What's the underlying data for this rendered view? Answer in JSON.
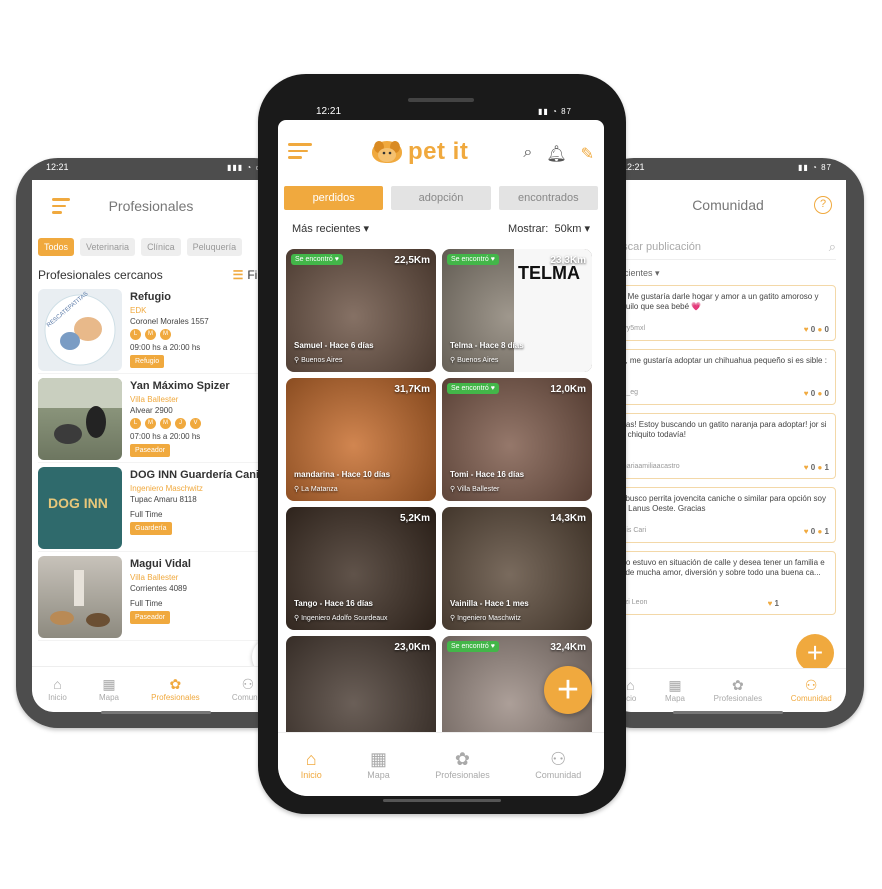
{
  "brand": {
    "name": "pet it",
    "accent": "#f0a93e"
  },
  "left": {
    "status": {
      "time": "12:21",
      "icons": "▮▮▮ ◔ ▭"
    },
    "title": "Profesionales",
    "chips": [
      "Todos",
      "Veterinaria",
      "Clínica",
      "Peluquería"
    ],
    "subheader": "Profesionales cercanos",
    "filter_label": "Filtra",
    "items": [
      {
        "name": "Refugio",
        "sub": "EDK",
        "address": "Coronel Morales 1557",
        "days": [
          "L",
          "M",
          "M"
        ],
        "hours": "09:00 hs a 20:00 hs",
        "tag": "Refugio",
        "thumb_text": "RESCATEPATITAS"
      },
      {
        "name": "Yan Máximo Spizer",
        "sub": "Villa Ballester",
        "address": "Alvear 2900",
        "days": [
          "L",
          "M",
          "M",
          "J",
          "V"
        ],
        "hours": "07:00 hs a 20:00 hs",
        "tag": "Paseador"
      },
      {
        "name": "DOG INN Guardería Canin",
        "sub": "Ingeniero Maschwitz",
        "address": "Tupac Amaru 8118",
        "days": [],
        "hours": "Full Time",
        "tag": "Guardería",
        "thumb_text": "DOG INN"
      },
      {
        "name": "Magui Vidal",
        "sub": "Villa Ballester",
        "address": "Corrientes 4089",
        "days": [],
        "hours": "Full Time",
        "tag": "Paseador"
      }
    ],
    "nav": [
      "Inicio",
      "Mapa",
      "Profesionales",
      "Comunid"
    ]
  },
  "center": {
    "status": {
      "time": "12:21",
      "icons": "▮▮ ◔ 87"
    },
    "tabs": [
      "perdidos",
      "adopción",
      "encontrados"
    ],
    "sort": "Más recientes",
    "show_label": "Mostrar:",
    "show_value": "50km",
    "cards": [
      {
        "dist": "22,5Km",
        "found": "Se encontró ♥",
        "name": "Samuel - Hace 6 días",
        "loc": "Buenos Aires",
        "bg": "#6b5243"
      },
      {
        "dist": "23,3Km",
        "found": "Se encontró ♥",
        "name": "Telma - Hace 8 días",
        "loc": "Buenos Aires",
        "bg": "#8a8174",
        "poster": "TELMA"
      },
      {
        "dist": "31,7Km",
        "found": "",
        "name": "mandarina - Hace 10 días",
        "loc": "La Matanza",
        "bg": "#c76b2a"
      },
      {
        "dist": "12,0Km",
        "found": "Se encontró ♥",
        "name": "Tomi - Hace 16 días",
        "loc": "Villa Ballester",
        "bg": "#7e5a4a"
      },
      {
        "dist": "5,2Km",
        "found": "",
        "name": "Tango - Hace 16 días",
        "loc": "Ingeniero Adolfo Sourdeaux",
        "bg": "#3d2d22"
      },
      {
        "dist": "14,3Km",
        "found": "",
        "name": "Vainilla - Hace 1 mes",
        "loc": "Ingeniero Maschwitz",
        "bg": "#5c4a3a"
      },
      {
        "dist": "23,0Km",
        "found": "",
        "name": "",
        "loc": "",
        "bg": "#4a3c33"
      },
      {
        "dist": "32,4Km",
        "found": "Se encontró ♥",
        "name": "",
        "loc": "",
        "bg": "#9a8a82"
      }
    ],
    "nav": [
      "Inicio",
      "Mapa",
      "Profesionales",
      "Comunidad"
    ]
  },
  "right": {
    "status": {
      "time": "12:21",
      "icons": "▮▮ ◔ 87"
    },
    "title": "Comunidad",
    "search_placeholder": "uscar publicación",
    "sort": "recientes",
    "posts": [
      {
        "text": "la! Me gustaría darle hogar y amor a un gatito amoroso y nquilo que sea bebé 💗",
        "user": "-7vy5mxl",
        "likes": "0",
        "comments": "0"
      },
      {
        "text": "la , me gustaría adoptar un chihuahua pequeño si es sible :(",
        "user": "gle_eg",
        "likes": "0",
        "comments": "0"
      },
      {
        "text": "enas! Estoy buscando un gatito naranja para adoptar! jor si es chiquito todavía!",
        "user": "emariaamiliaacastro",
        "likes": "0",
        "comments": "1"
      },
      {
        "text": "lo busco perrita jovencita caniche o similar para opción soy de Lanus Oeste. Gracias",
        "user": "nelis Cari",
        "likes": "0",
        "comments": "1"
      },
      {
        "text": "ngo estuvo en situación de calle y desea tener un familia e le de mucha amor, diversión y sobre todo una buena ca...",
        "user": "anzi Leon",
        "likes": "1",
        "comments": ""
      }
    ],
    "nav": [
      "icio",
      "Mapa",
      "Profesionales",
      "Comunidad"
    ]
  }
}
